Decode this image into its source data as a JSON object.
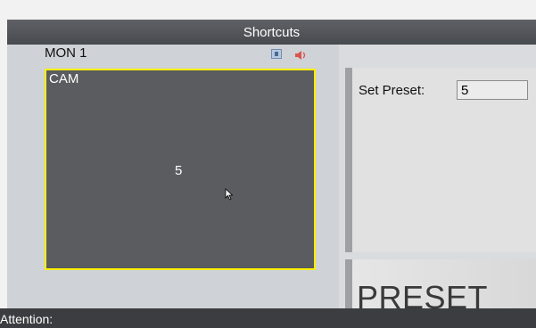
{
  "window": {
    "title": "Shortcuts"
  },
  "monitor": {
    "label": "MON 1",
    "icons": [
      "fullscreen-icon",
      "speaker-icon"
    ]
  },
  "video": {
    "camera_label": "CAM",
    "camera_number": "5",
    "border_color": "#ffef00"
  },
  "preset_panel": {
    "set_preset_label": "Set Preset:",
    "set_preset_value": "5"
  },
  "preset_button": {
    "label": "PRESET"
  },
  "status": {
    "attention_label": "Attention:"
  }
}
